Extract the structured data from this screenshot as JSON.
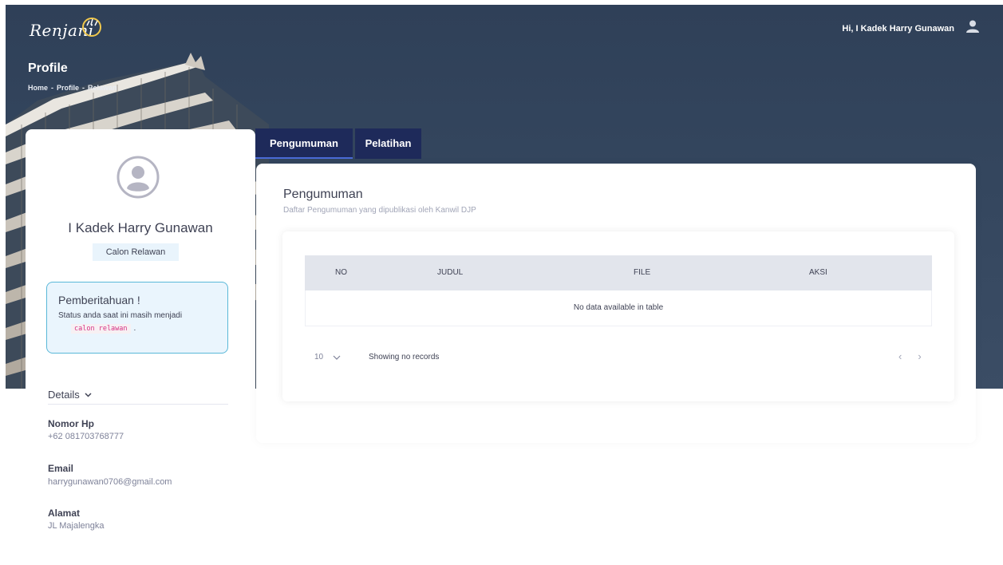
{
  "header": {
    "logo_text": "Renjani",
    "page_title": "Profile",
    "breadcrumb": [
      "Home",
      "-",
      "Profile",
      "-",
      "Relawan"
    ],
    "greeting": "Hi, I Kadek Harry Gunawan",
    "user_icon": "user-icon"
  },
  "profile": {
    "name": "I Kadek Harry Gunawan",
    "role": "Calon Relawan",
    "avatar_icon": "user-circle-icon",
    "alert": {
      "title": "Pemberitahuan !",
      "text": "Status anda saat ini masih menjadi",
      "code": "calon relawan",
      "tail": "."
    },
    "details_label": "Details",
    "details": [
      {
        "label": "Nomor Hp",
        "value": "+62 081703768777"
      },
      {
        "label": "Email",
        "value": "harrygunawan0706@gmail.com"
      },
      {
        "label": "Alamat",
        "value": "JL Majalengka"
      }
    ]
  },
  "tabs": [
    {
      "label": "Pengumuman",
      "active": true
    },
    {
      "label": "Pelatihan",
      "active": false
    }
  ],
  "content": {
    "title": "Pengumuman",
    "subtitle": "Daftar Pengumuman yang dipublikasi oleh Kanwil DJP",
    "table": {
      "columns": [
        "NO",
        "JUDUL",
        "FILE",
        "AKSI"
      ],
      "empty_text": "No data available in table"
    },
    "page_size": "10",
    "records_info": "Showing no records",
    "pager": {
      "prev": "‹",
      "next": "›"
    }
  },
  "colors": {
    "tab_bg": "#1e2a5a",
    "hero_bg": "#34465e",
    "alert_border": "#5ab8d8"
  }
}
